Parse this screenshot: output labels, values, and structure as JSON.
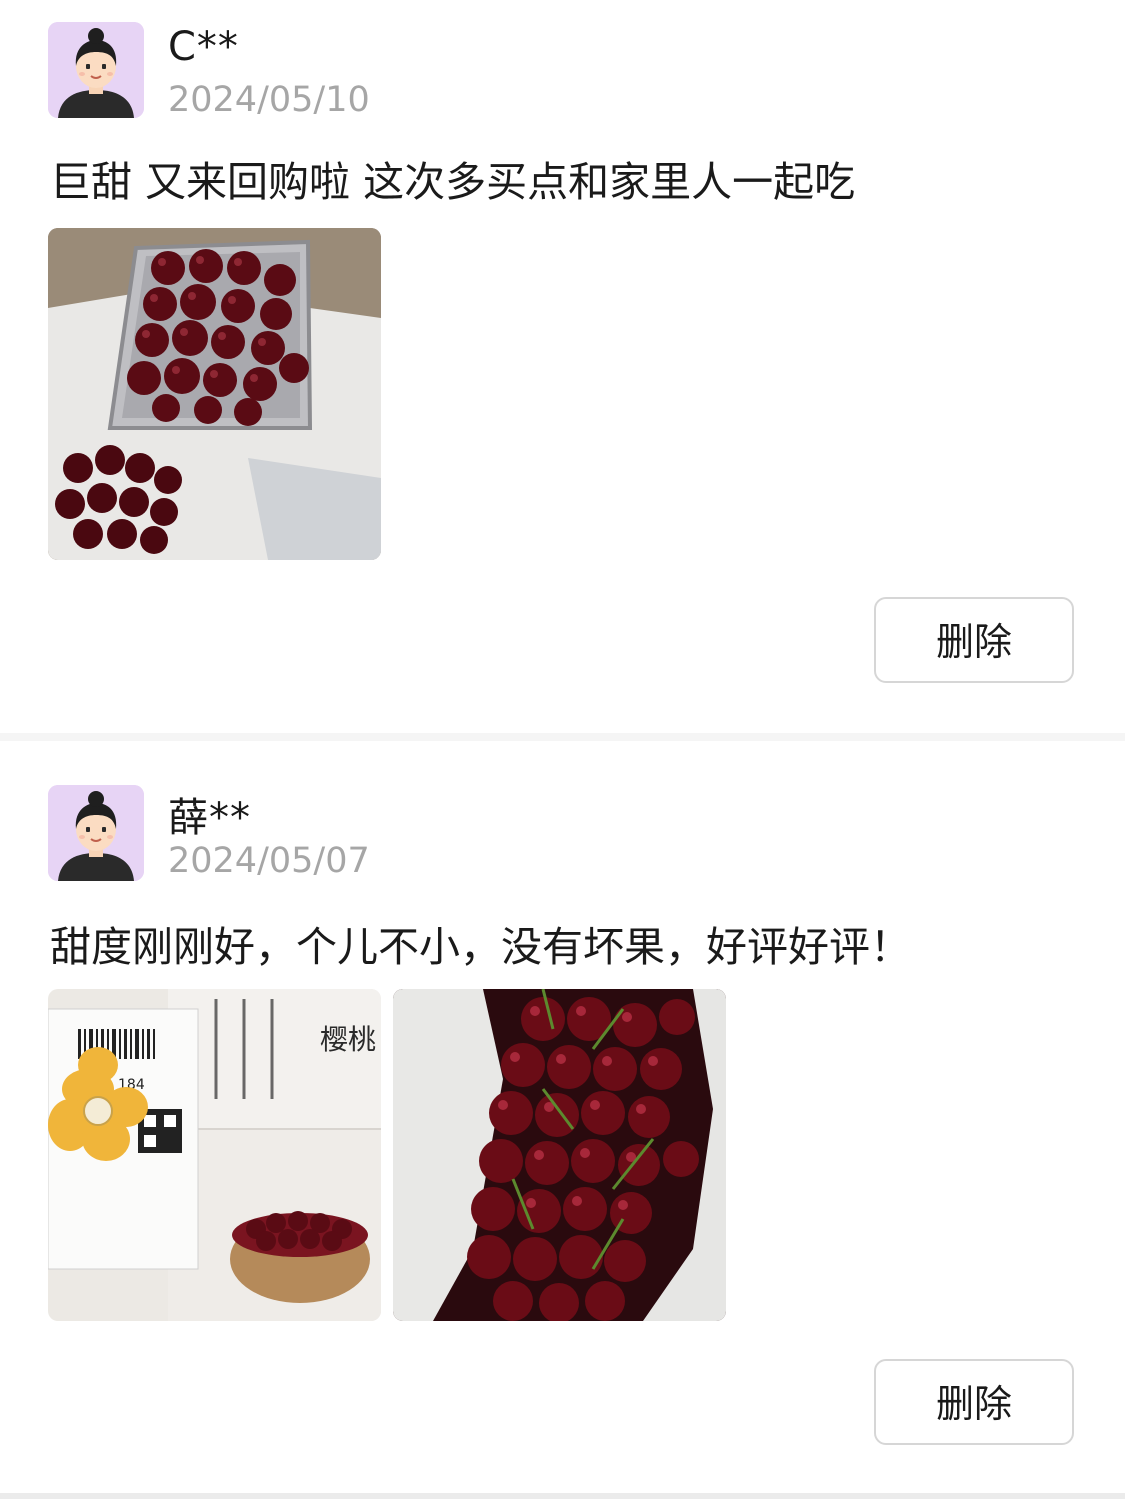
{
  "reviews": [
    {
      "username": "C**",
      "date": "2024/05/10",
      "comment": "巨甜 又来回购啦 这次多买点和家里人一起吃",
      "delete_label": "删除",
      "photos": [
        "cherries-in-metal-tray-photo"
      ]
    },
    {
      "username": "薛**",
      "date": "2024/05/07",
      "comment": "甜度刚刚好，个儿不小，没有坏果，好评好评！",
      "delete_label": "删除",
      "photos": [
        "package-box-with-label-photo",
        "cherries-in-bag-photo"
      ]
    }
  ],
  "colors": {
    "avatar_bg": "#e7d4f5",
    "date_text": "#a6a6a6",
    "button_border": "#d6d6d6",
    "separator": "#f5f5f5"
  }
}
